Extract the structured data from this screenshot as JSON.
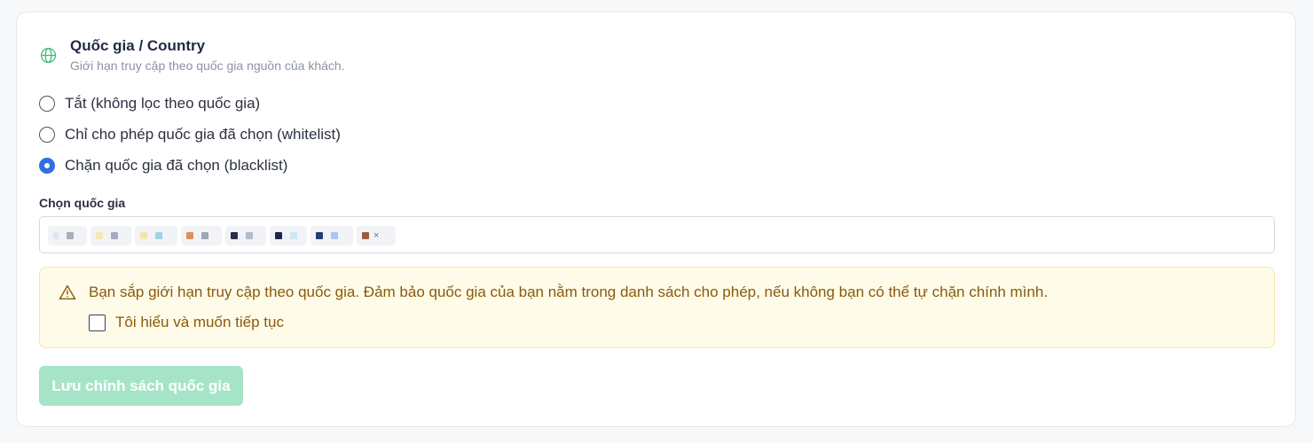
{
  "section": {
    "title": "Quốc gia / Country",
    "subtitle": "Giới hạn truy cập theo quốc gia nguồn của khách.",
    "icon": "globe-icon",
    "accent_color": "#3fb87f"
  },
  "mode_options": [
    {
      "label": "Tắt (không lọc theo quốc gia)",
      "checked": false
    },
    {
      "label": "Chỉ cho phép quốc gia đã chọn (whitelist)",
      "checked": false
    },
    {
      "label": "Chặn quốc gia đã chọn (blacklist)",
      "checked": true
    }
  ],
  "country_select": {
    "label": "Chọn quốc gia",
    "selected_count": 8,
    "remove_glyph": "×"
  },
  "alert": {
    "icon": "warning-icon",
    "message": "Bạn sắp giới hạn truy cập theo quốc gia. Đảm bảo quốc gia của bạn nằm trong danh sách cho phép, nếu không bạn có thể tự chặn chính mình.",
    "confirm_label": "Tôi hiểu và muốn tiếp tục",
    "confirm_checked": false,
    "background_color": "#fefbe8",
    "text_color": "#8a5a0c"
  },
  "save_button": {
    "label": "Lưu chính sách quốc gia",
    "disabled": true,
    "color": "#a6e4c8"
  },
  "colors": {
    "radio_selected": "#2f6fe0"
  }
}
